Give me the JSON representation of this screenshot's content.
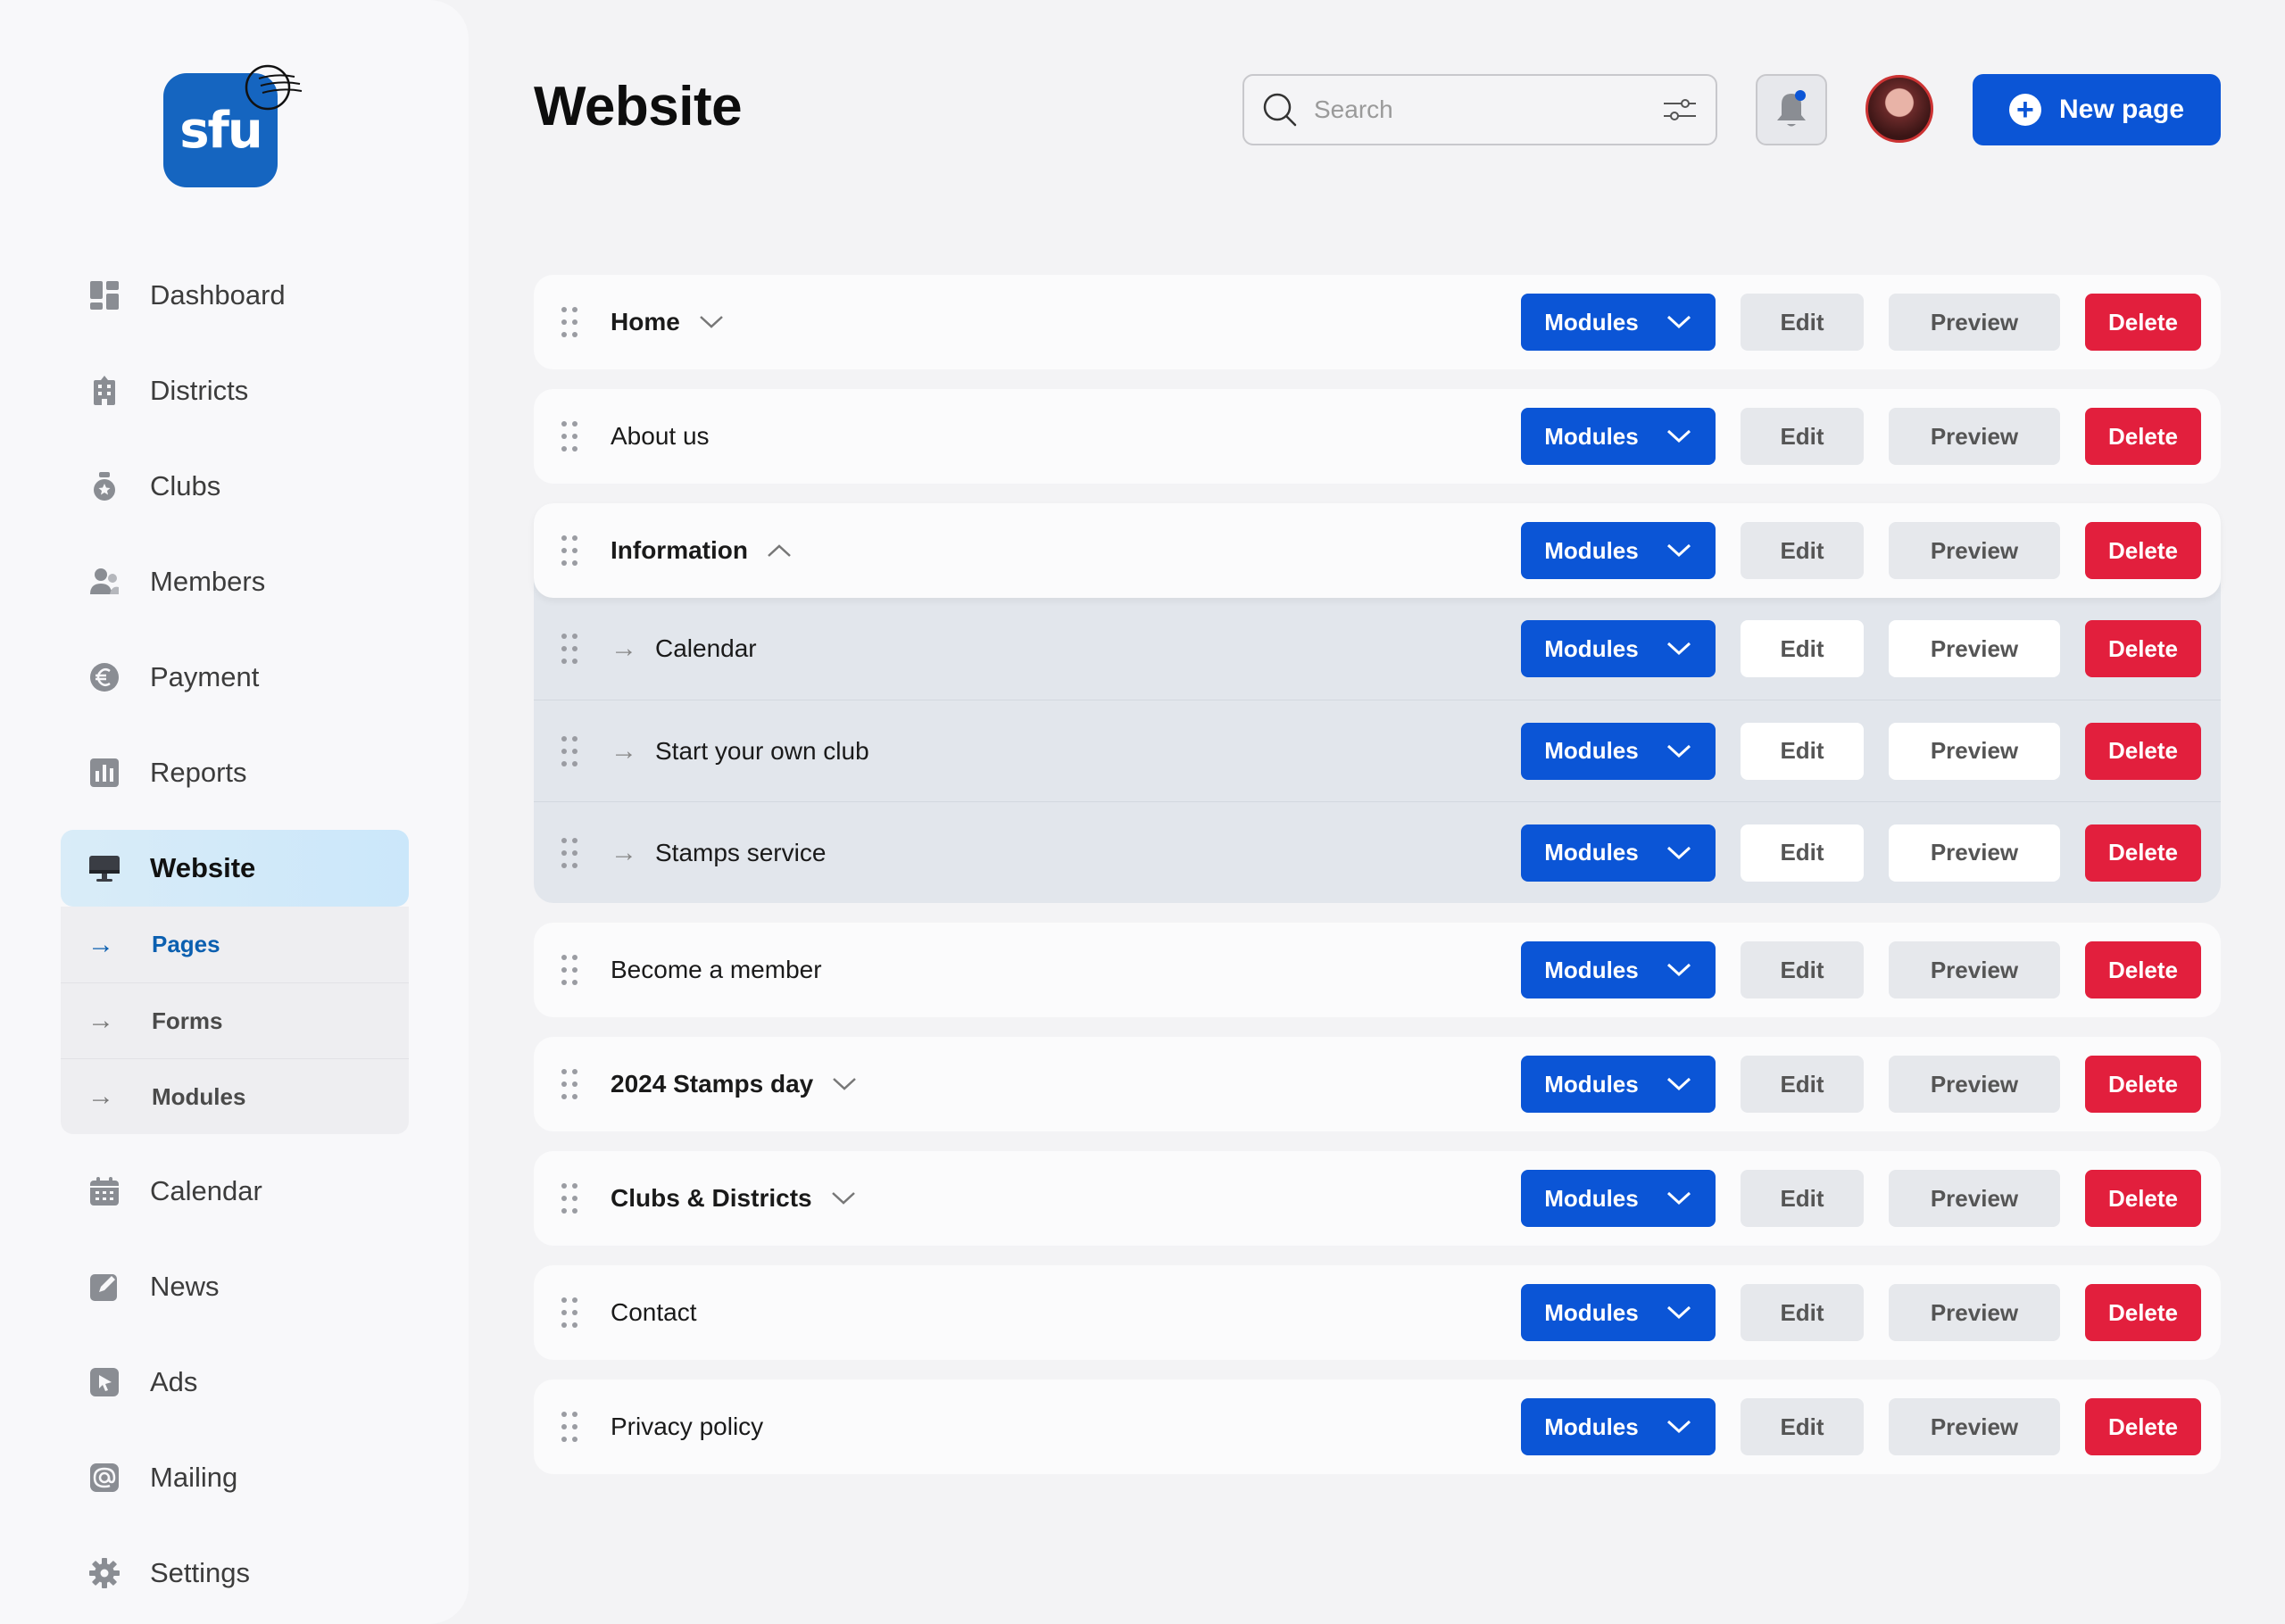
{
  "brand": {
    "logo_text": "sfu"
  },
  "sidebar": {
    "items": [
      {
        "label": "Dashboard",
        "icon": "dashboard-icon"
      },
      {
        "label": "Districts",
        "icon": "building-icon"
      },
      {
        "label": "Clubs",
        "icon": "club-icon"
      },
      {
        "label": "Members",
        "icon": "members-icon"
      },
      {
        "label": "Payment",
        "icon": "euro-icon"
      },
      {
        "label": "Reports",
        "icon": "chart-icon"
      },
      {
        "label": "Website",
        "icon": "monitor-icon",
        "active": true
      },
      {
        "label": "Calendar",
        "icon": "calendar-icon"
      },
      {
        "label": "News",
        "icon": "edit-icon"
      },
      {
        "label": "Ads",
        "icon": "cursor-icon"
      },
      {
        "label": "Mailing",
        "icon": "at-icon"
      },
      {
        "label": "Settings",
        "icon": "gear-icon"
      }
    ],
    "website_sub": [
      {
        "label": "Pages",
        "active": true
      },
      {
        "label": "Forms"
      },
      {
        "label": "Modules"
      }
    ]
  },
  "header": {
    "title": "Website",
    "search_placeholder": "Search",
    "new_page_label": "New page"
  },
  "buttons": {
    "modules": "Modules",
    "edit": "Edit",
    "preview": "Preview",
    "delete": "Delete"
  },
  "pages": [
    {
      "title": "Home",
      "bold": true,
      "toggle": "collapsed"
    },
    {
      "title": "About us"
    },
    {
      "title": "Information",
      "bold": true,
      "toggle": "expanded",
      "children": [
        "Calendar",
        "Start your own club",
        "Stamps service"
      ]
    },
    {
      "title": "Become a member"
    },
    {
      "title": "2024 Stamps day",
      "bold": true,
      "toggle": "collapsed"
    },
    {
      "title": "Clubs & Districts",
      "bold": true,
      "toggle": "collapsed"
    },
    {
      "title": "Contact"
    },
    {
      "title": "Privacy policy"
    }
  ],
  "colors": {
    "primary": "#0b55d6",
    "danger": "#e21f3d",
    "active_nav": "#cbe7fa",
    "accent_text": "#0b5fb0"
  }
}
